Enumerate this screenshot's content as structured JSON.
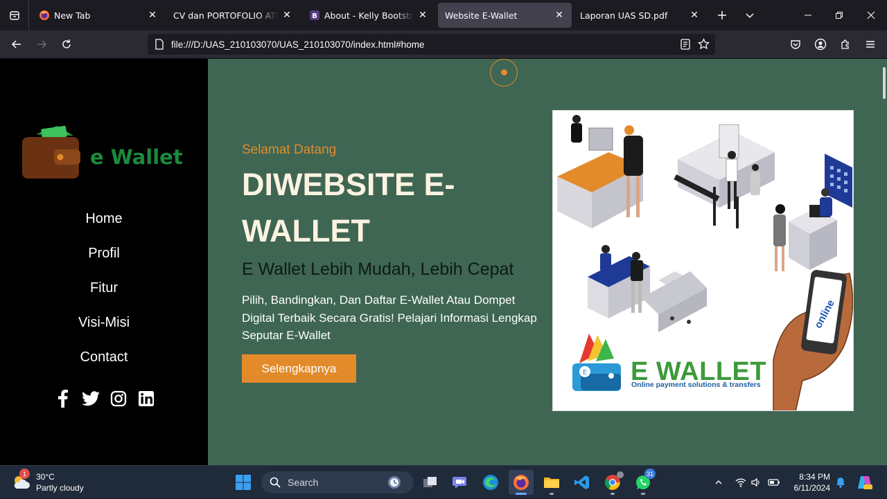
{
  "browser": {
    "tabs": [
      {
        "title": "New Tab",
        "icon": "firefox-icon"
      },
      {
        "title": "CV dan PORTOFOLIO ATIK SUM",
        "icon": "none"
      },
      {
        "title": "About - Kelly Bootstrap Tem",
        "icon": "bootstrap-icon"
      },
      {
        "title": "Website E-Wallet",
        "icon": "none"
      },
      {
        "title": "Laporan UAS SD.pdf",
        "icon": "none"
      }
    ],
    "url": "file:///D:/UAS_210103070/UAS_210103070/index.html#home"
  },
  "sidebar": {
    "logo_text": "e Wallet",
    "menu": [
      {
        "label": "Home"
      },
      {
        "label": "Profil"
      },
      {
        "label": "Fitur"
      },
      {
        "label": "Visi-Misi"
      },
      {
        "label": "Contact"
      }
    ],
    "social_icons": [
      "facebook-icon",
      "twitter-icon",
      "instagram-icon",
      "linkedin-icon"
    ]
  },
  "hero": {
    "subtitle": "Selamat Datang",
    "title": "DIWEBSITE E-WALLET",
    "tagline": "E Wallet Lebih Mudah, Lebih Cepat",
    "description": "Pilih, Bandingkan, Dan Daftar E-Wallet Atau Dompet Digital Terbaik Secara Gratis! Pelajari Informasi Lengkap Seputar E-Wallet",
    "button_label": "Selengkapnya",
    "image": {
      "brand_text": "E WALLET",
      "brand_sub": "Online payment solutions & transfers",
      "phone_text": "online"
    }
  },
  "colors": {
    "accent": "#e38b2b",
    "main_bg": "#3e6653",
    "sidebar_bg": "#000000",
    "logo_green": "#1b8a3d"
  },
  "taskbar": {
    "weather": {
      "temp": "30°C",
      "condition": "Partly cloudy",
      "badge": "1"
    },
    "search_placeholder": "Search",
    "whatsapp_badge": "31",
    "time": "8:34 PM",
    "date": "6/11/2024"
  }
}
